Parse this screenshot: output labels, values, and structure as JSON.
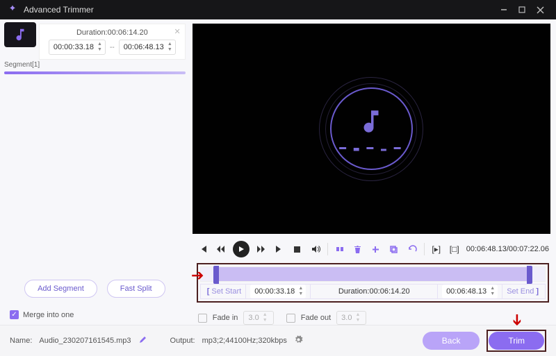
{
  "titlebar": {
    "title": "Advanced Trimmer"
  },
  "segment": {
    "duration_label": "Duration:00:06:14.20",
    "start": "00:00:33.18",
    "sep": "--",
    "end": "00:06:48.13",
    "label": "Segment[1]"
  },
  "leftButtons": {
    "add": "Add Segment",
    "split": "Fast Split",
    "merge": "Merge into one"
  },
  "controls": {
    "timecode": "00:06:48.13/00:07:22.06"
  },
  "trim": {
    "setStart": "Set Start",
    "start": "00:00:33.18",
    "duration": "Duration:00:06:14.20",
    "end": "00:06:48.13",
    "setEnd": "Set End"
  },
  "fade": {
    "inLabel": "Fade in",
    "inVal": "3.0",
    "outLabel": "Fade out",
    "outVal": "3.0"
  },
  "footer": {
    "nameLabel": "Name:",
    "name": "Audio_230207161545.mp3",
    "outputLabel": "Output:",
    "output": "mp3;2;44100Hz;320kbps",
    "back": "Back",
    "trim": "Trim"
  }
}
